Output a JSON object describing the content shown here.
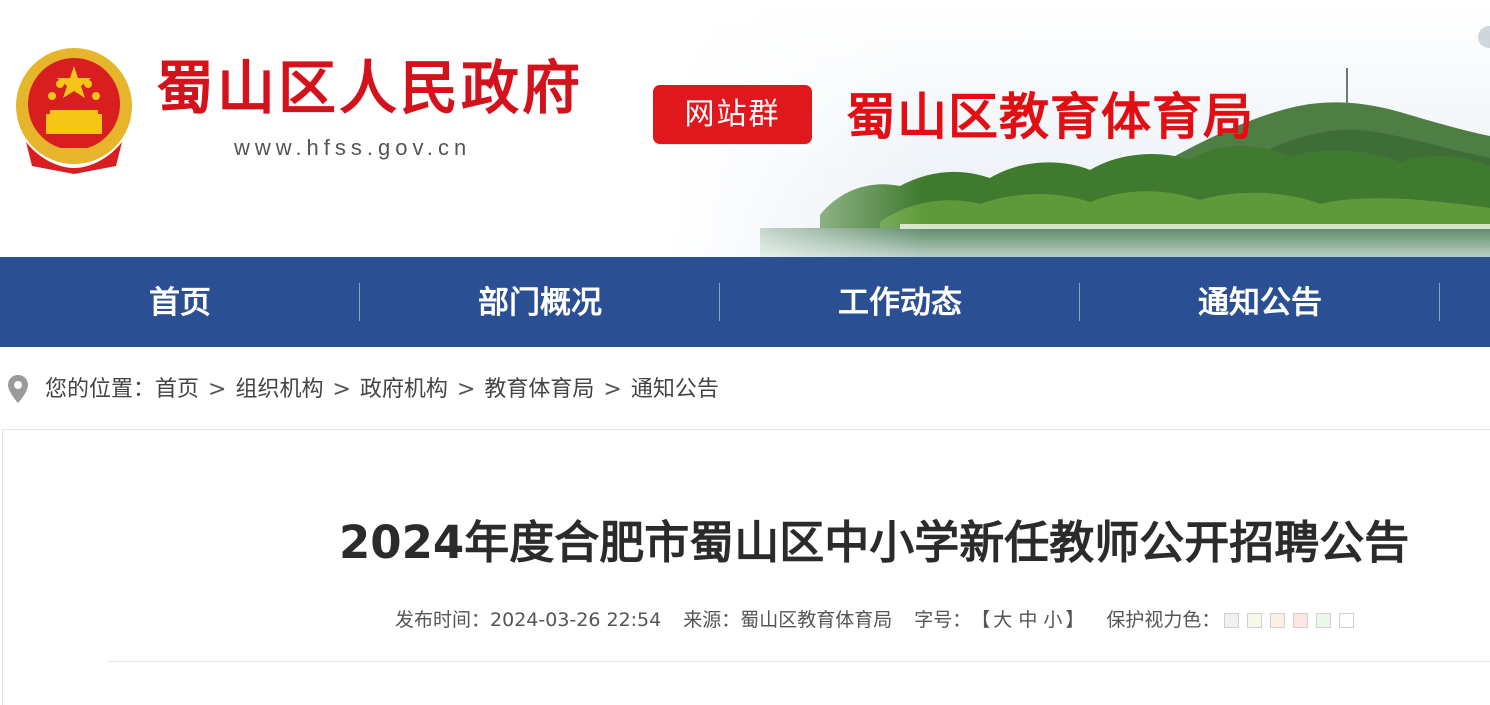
{
  "header": {
    "gov_name": "蜀山区人民政府",
    "gov_url": "www.hfss.gov.cn",
    "site_group_label": "网站群",
    "department_title": "蜀山区教育体育局"
  },
  "nav": {
    "items": [
      {
        "label": "首页"
      },
      {
        "label": "部门概况"
      },
      {
        "label": "工作动态"
      },
      {
        "label": "通知公告"
      }
    ]
  },
  "breadcrumb": {
    "prefix": "您的位置：",
    "items": [
      "首页",
      "组织机构",
      "政府机构",
      "教育体育局",
      "通知公告"
    ],
    "separator": ">"
  },
  "article": {
    "title": "2024年度合肥市蜀山区中小学新任教师公开招聘公告",
    "publish_label": "发布时间：",
    "publish_time": "2024-03-26 22:54",
    "source_label": "来源：",
    "source": "蜀山区教育体育局",
    "font_size_label": "字号：",
    "font_size_open": "【",
    "font_size_options": [
      "大",
      "中",
      "小"
    ],
    "font_size_close": "】",
    "eye_color_label": "保护视力色：",
    "eye_colors": [
      "#eef0f4",
      "#f7f9e8",
      "#fcf1e4",
      "#fde6e2",
      "#ecf9e8",
      "#ffffff"
    ]
  },
  "colors": {
    "nav_bg": "#2a5093",
    "brand_red": "#e0171d"
  }
}
